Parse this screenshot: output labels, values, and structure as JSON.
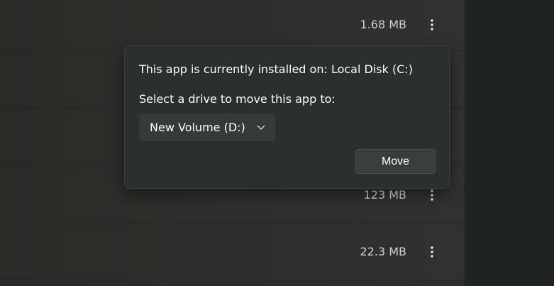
{
  "apps": [
    {
      "size": "1.68 MB"
    },
    {
      "size": ""
    },
    {
      "size": ""
    },
    {
      "size": "123 MB"
    },
    {
      "size": "22.3 MB"
    }
  ],
  "move_popup": {
    "installed_text": "This app is currently installed on: Local Disk (C:)",
    "select_label": "Select a drive to move this app to:",
    "selected_drive": "New Volume (D:)",
    "move_button": "Move"
  },
  "icons": {
    "more": "more-options-icon",
    "chevron": "chevron-down-icon"
  }
}
